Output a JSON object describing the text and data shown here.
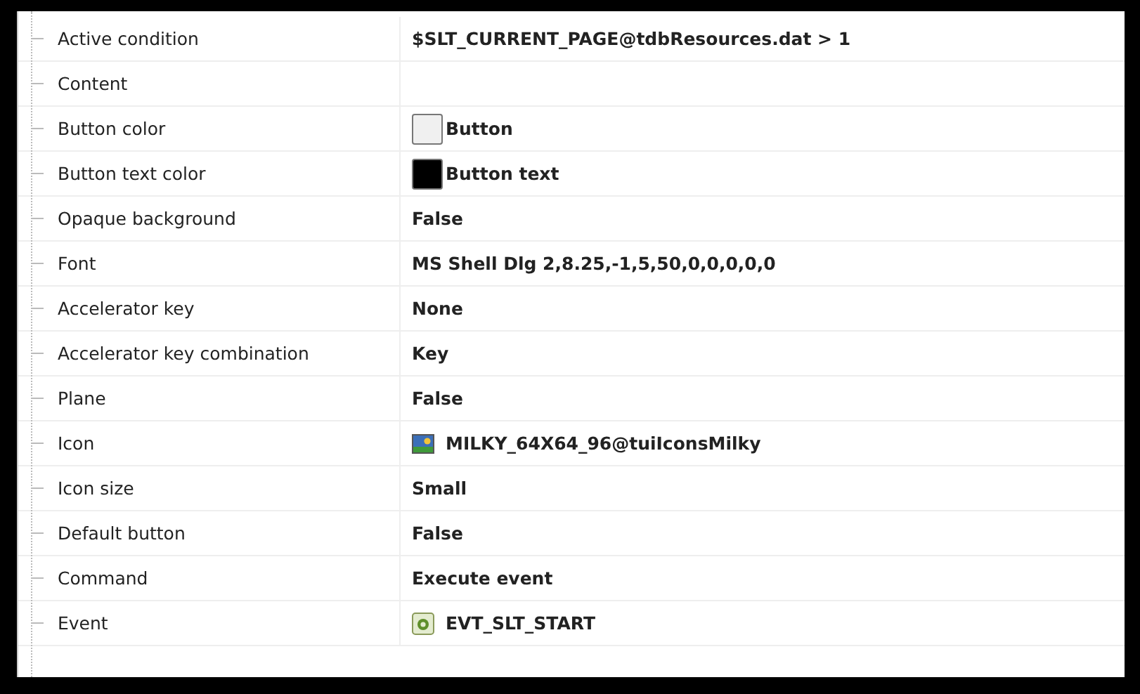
{
  "properties": [
    {
      "label": "Active condition",
      "kind": "text",
      "value": "$SLT_CURRENT_PAGE@tdbResources.dat > 1"
    },
    {
      "label": "Content",
      "kind": "empty"
    },
    {
      "label": "Button color",
      "kind": "color",
      "color": "#f0f0f0",
      "value": "Button"
    },
    {
      "label": "Button text color",
      "kind": "color",
      "color": "#000000",
      "value": "Button text"
    },
    {
      "label": "Opaque background",
      "kind": "text",
      "value": "False"
    },
    {
      "label": "Font",
      "kind": "text",
      "value": "MS Shell Dlg 2,8.25,-1,5,50,0,0,0,0,0"
    },
    {
      "label": "Accelerator key",
      "kind": "text",
      "value": "None"
    },
    {
      "label": "Accelerator key combination",
      "kind": "text",
      "value": "Key"
    },
    {
      "label": "Plane",
      "kind": "text",
      "value": "False"
    },
    {
      "label": "Icon",
      "kind": "image",
      "value": "MILKY_64X64_96@tuiIconsMilky"
    },
    {
      "label": "Icon size",
      "kind": "text",
      "value": "Small"
    },
    {
      "label": "Default button",
      "kind": "text",
      "value": "False"
    },
    {
      "label": "Command",
      "kind": "text",
      "value": "Execute event"
    },
    {
      "label": "Event",
      "kind": "event",
      "value": "EVT_SLT_START"
    }
  ]
}
